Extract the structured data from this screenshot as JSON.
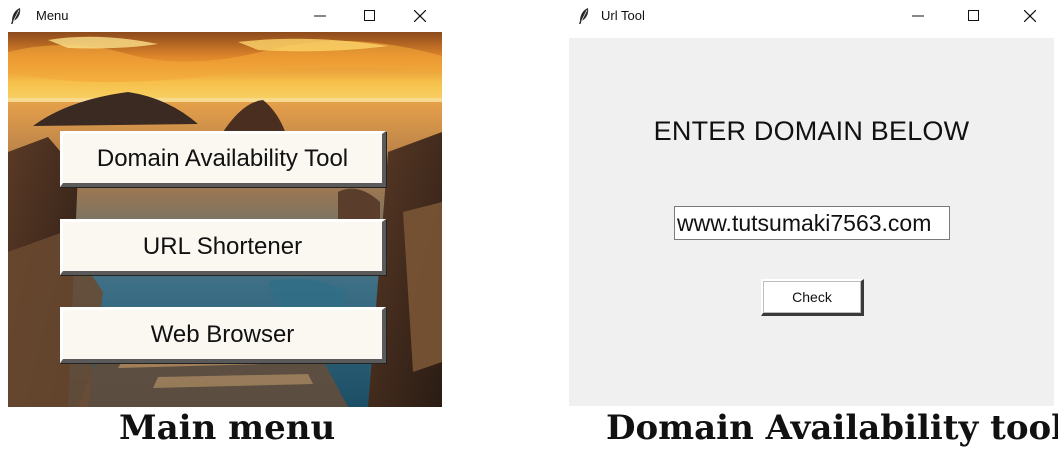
{
  "menu_window": {
    "title": "Menu",
    "buttons": [
      "Domain Availability Tool",
      "URL Shortener",
      "Web Browser"
    ]
  },
  "url_window": {
    "title": "Url Tool",
    "heading": "ENTER DOMAIN BELOW",
    "domain_value": "www.tutsumaki7563.com",
    "check_label": "Check"
  },
  "captions": {
    "left": "Main menu",
    "right": "Domain Availability tool"
  },
  "colors": {
    "button_face": "#fbf7f1",
    "url_background": "#f0f0f0"
  }
}
